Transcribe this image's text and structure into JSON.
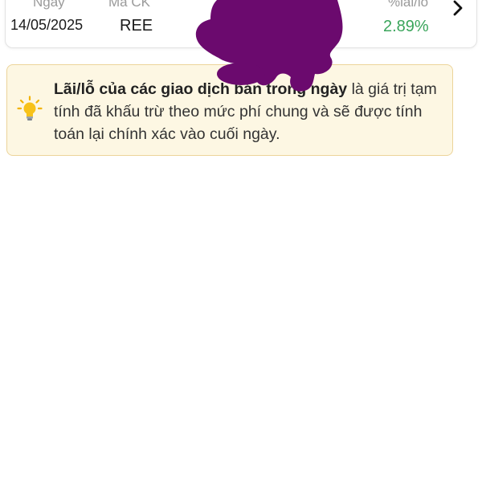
{
  "trade": {
    "headers": {
      "date": "Ngày",
      "ticker": "Mã CK",
      "pnl": "%lãi/lỗ"
    },
    "date": "14/05/2025",
    "ticker": "REE",
    "pnl_percent": "2.89%",
    "pnl_color": "#3aa55b",
    "chevron_icon": "chevron-right-icon"
  },
  "notice": {
    "icon": "lightbulb-icon",
    "bold_text": "Lãi/lỗ của các giao dịch bán trong ngày",
    "body_text": " là giá trị tạm tính đã khấu trừ theo mức phí chung và sẽ được tính toán lại chính xác vào cuối ngày.",
    "background": "#fdf7e3",
    "border": "#ecd49a"
  },
  "redaction_color": "#6b0a6e"
}
